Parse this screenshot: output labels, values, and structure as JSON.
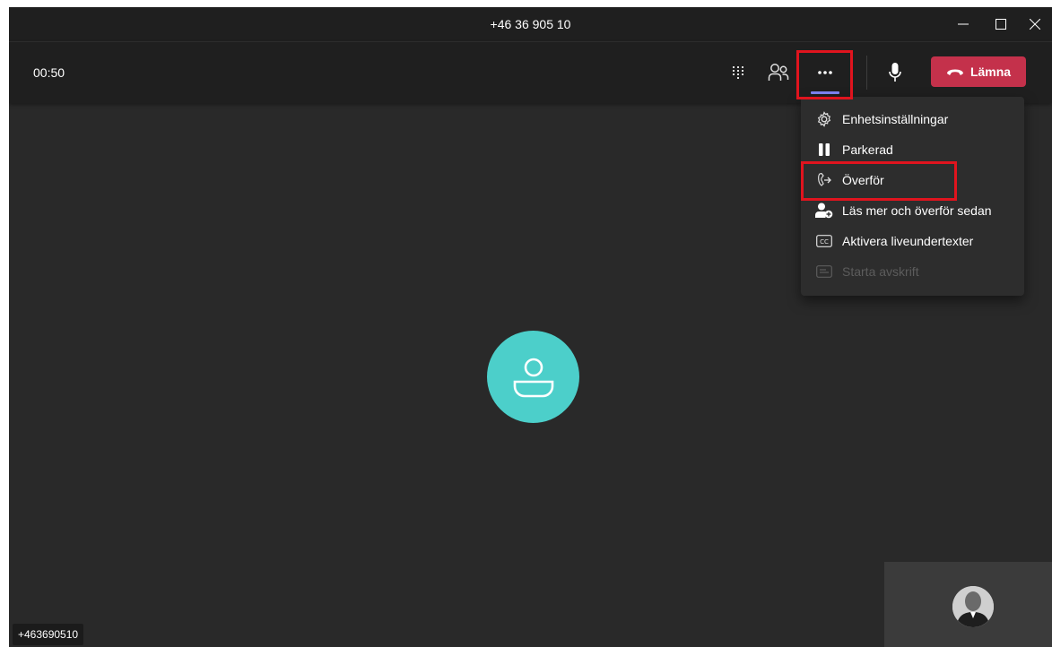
{
  "window": {
    "title": "+46 36 905 10"
  },
  "toolbar": {
    "timer": "00:50",
    "leave_label": "Lämna",
    "icons": [
      "dialpad-icon",
      "people-icon",
      "more-options-icon",
      "microphone-icon",
      "hang-up-icon"
    ]
  },
  "menu": {
    "items": [
      {
        "label": "Enhetsinställningar",
        "icon": "gear-icon",
        "enabled": true
      },
      {
        "label": "Parkerad",
        "icon": "pause-icon",
        "enabled": true
      },
      {
        "label": "Överför",
        "icon": "transfer-icon",
        "enabled": true
      },
      {
        "label": "Läs mer och överför sedan",
        "icon": "person-add-icon",
        "enabled": true
      },
      {
        "label": "Aktivera liveundertexter",
        "icon": "closed-caption-icon",
        "enabled": true
      },
      {
        "label": "Starta avskrift",
        "icon": "transcript-icon",
        "enabled": false
      }
    ]
  },
  "call": {
    "caller_label": "+463690510"
  },
  "colors": {
    "accent": "#7f85f5",
    "leave_red": "#c4314b",
    "avatar_teal": "#4ccfca",
    "highlight_red": "#e0141e"
  }
}
